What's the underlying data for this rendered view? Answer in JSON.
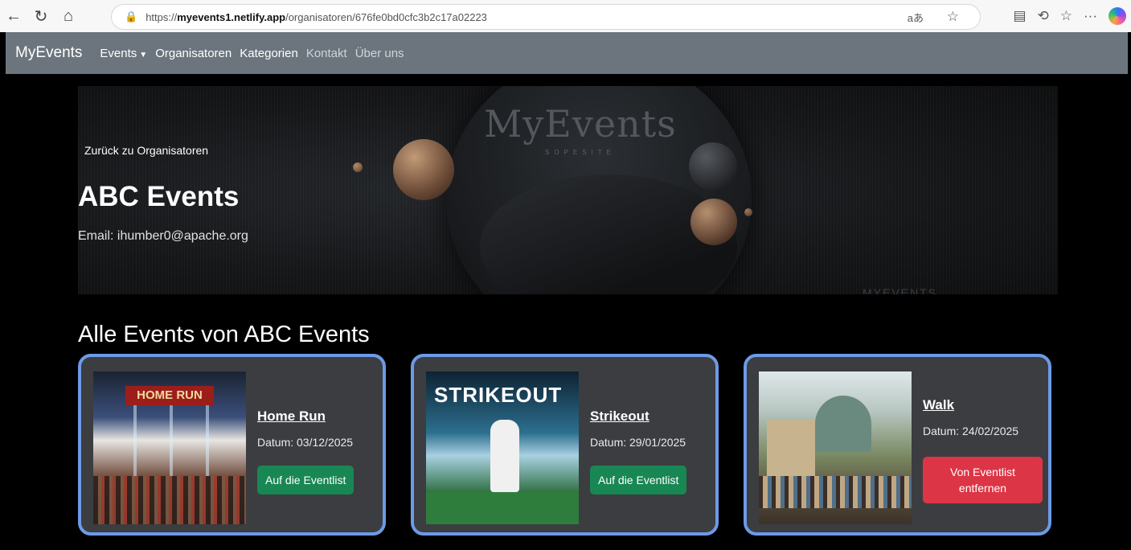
{
  "browser": {
    "url_prefix": "https://",
    "url_host": "myevents1.netlify.app",
    "url_path": "/organisatoren/676fe0bd0cfc3b2c17a02223"
  },
  "nav": {
    "brand": "MyEvents",
    "events": "Events",
    "organisatoren": "Organisatoren",
    "kategorien": "Kategorien",
    "kontakt": "Kontakt",
    "ueber_uns": "Über uns"
  },
  "hero": {
    "logo_text": "MyEvents",
    "logo_sub": "SOPESITE",
    "watermark": "MYEVENTS"
  },
  "organizer": {
    "back_link": "Zurück zu Organisatoren",
    "name": "ABC Events",
    "email": "Email: ihumber0@apache.org"
  },
  "section": {
    "title": "Alle Events von ABC Events"
  },
  "events": [
    {
      "title": "Home Run",
      "date": "Datum: 03/12/2025",
      "button": "Auf die Eventlist",
      "image_text": "HOME RUN"
    },
    {
      "title": "Strikeout",
      "date": "Datum: 29/01/2025",
      "button": "Auf die Eventlist",
      "image_text": "STRIKEOUT"
    },
    {
      "title": "Walk",
      "date": "Datum: 24/02/2025",
      "button": "Von Eventlist entfernen",
      "image_text": ""
    }
  ],
  "colors": {
    "navbar": "#6c757d",
    "card_border": "#6d9ae8",
    "card_bg": "#3b3d40",
    "add_button": "#198754",
    "remove_button": "#dc3545"
  }
}
